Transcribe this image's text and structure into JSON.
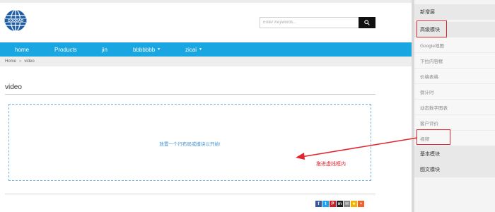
{
  "search": {
    "placeholder": "Enter Keywords..."
  },
  "nav": {
    "items": [
      {
        "label": "home",
        "dropdown": false
      },
      {
        "label": "Products",
        "dropdown": false
      },
      {
        "label": "jin",
        "dropdown": false
      },
      {
        "label": "bbbbbbb",
        "dropdown": true
      },
      {
        "label": "zicai",
        "dropdown": true
      }
    ]
  },
  "breadcrumb": {
    "home": "Home",
    "separator": "»",
    "current": "video"
  },
  "page": {
    "title": "video"
  },
  "drop_zone": {
    "text": "放置一个行布局或模块以开始!"
  },
  "annotation": {
    "text": "拖进虚线框内"
  },
  "share_icons": [
    {
      "name": "facebook-icon",
      "glyph": "f",
      "color": "#3b5998"
    },
    {
      "name": "twitter-icon",
      "glyph": "t",
      "color": "#1da1f2"
    },
    {
      "name": "pinterest-icon",
      "glyph": "P",
      "color": "#cb2027"
    },
    {
      "name": "myspace-icon",
      "glyph": "m",
      "color": "#222222"
    },
    {
      "name": "email-icon",
      "glyph": "✉",
      "color": "#888888"
    },
    {
      "name": "favorite-icon",
      "glyph": "★",
      "color": "#f0b400"
    },
    {
      "name": "more-icon",
      "glyph": "+",
      "color": "#f2602c"
    }
  ],
  "panel": {
    "items": [
      {
        "label": "新增层",
        "kind": "category"
      },
      {
        "label": "高级模块",
        "kind": "category"
      },
      {
        "label": "Google地图",
        "kind": "sub"
      },
      {
        "label": "下拉内容框",
        "kind": "sub"
      },
      {
        "label": "价格表格",
        "kind": "sub"
      },
      {
        "label": "倒计时",
        "kind": "sub"
      },
      {
        "label": "动态数字图表",
        "kind": "sub"
      },
      {
        "label": "客户评价",
        "kind": "sub"
      },
      {
        "label": "视频",
        "kind": "sub"
      },
      {
        "label": "基本模块",
        "kind": "category"
      },
      {
        "label": "图文模块",
        "kind": "category"
      }
    ]
  },
  "colors": {
    "nav_bg": "#1aa6e1",
    "annotation_red": "#e0262d",
    "dashed_border": "#6fb7e4"
  }
}
